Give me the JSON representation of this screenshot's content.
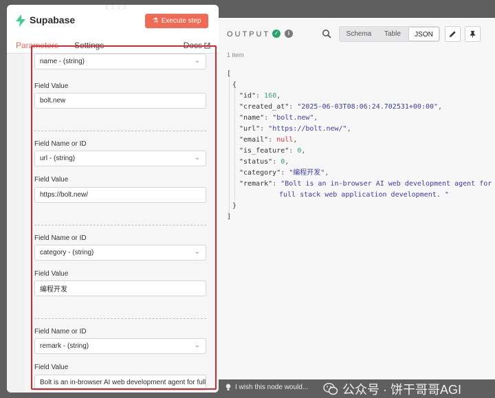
{
  "node": {
    "title": "Supabase",
    "execute_label": "Execute step",
    "tabs": [
      "Parameters",
      "Settings"
    ],
    "docs_label": "Docs"
  },
  "fields": [
    {
      "select_value": "name - (string)",
      "value_label": "Field Value",
      "value": "bolt.new"
    },
    {
      "name_label": "Field Name or ID",
      "select_value": "url - (string)",
      "value_label": "Field Value",
      "value": "https://bolt.new/"
    },
    {
      "name_label": "Field Name or ID",
      "select_value": "category - (string)",
      "value_label": "Field Value",
      "value": "编程开发"
    },
    {
      "name_label": "Field Name or ID",
      "select_value": "remark - (string)",
      "value_label": "Field Value",
      "value": "Bolt is an in-browser AI web development agent for full stack web application development. "
    }
  ],
  "output": {
    "title": "OUTPUT",
    "views": [
      "Schema",
      "Table",
      "JSON"
    ],
    "active_view": "JSON",
    "item_count": "1 item",
    "json_lines": [
      {
        "key": "id",
        "value": "160",
        "type": "number"
      },
      {
        "key": "created_at",
        "value": "\"2025-06-03T08:06:24.702531+00:00\"",
        "type": "string"
      },
      {
        "key": "name",
        "value": "\"bolt.new\"",
        "type": "string"
      },
      {
        "key": "url",
        "value": "\"https://bolt.new/\"",
        "type": "string"
      },
      {
        "key": "email",
        "value": "null",
        "type": "null"
      },
      {
        "key": "is_feature",
        "value": "0",
        "type": "number"
      },
      {
        "key": "status",
        "value": "0",
        "type": "number"
      },
      {
        "key": "category",
        "value": "\"编程开发\"",
        "type": "string"
      },
      {
        "key": "remark",
        "value": "\"Bolt is an in-browser AI web development agent for",
        "value_cont": "full stack web application development. \"",
        "type": "string"
      }
    ]
  },
  "footer": {
    "feedback_label": "I wish this node would...",
    "watermark_text": "公众号 · 饼干哥哥AGI"
  },
  "colors": {
    "accent": "#ef6b55",
    "highlight_border": "#d7262e",
    "success": "#29a36a"
  }
}
